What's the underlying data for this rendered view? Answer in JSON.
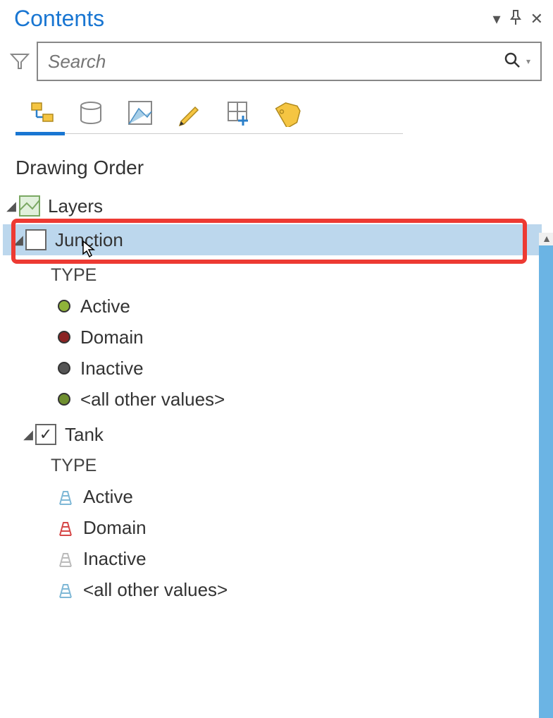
{
  "panel": {
    "title": "Contents"
  },
  "search": {
    "placeholder": "Search"
  },
  "section": {
    "heading": "Drawing Order"
  },
  "tree": {
    "root_label": "Layers",
    "layer1": {
      "name": "Junction",
      "type_heading": "TYPE",
      "symbols": [
        {
          "label": "Active"
        },
        {
          "label": "Domain"
        },
        {
          "label": "Inactive"
        },
        {
          "label": "<all other values>"
        }
      ]
    },
    "layer2": {
      "name": "Tank",
      "type_heading": "TYPE",
      "symbols": [
        {
          "label": "Active"
        },
        {
          "label": "Domain"
        },
        {
          "label": "Inactive"
        },
        {
          "label": "<all other values>"
        }
      ]
    }
  }
}
